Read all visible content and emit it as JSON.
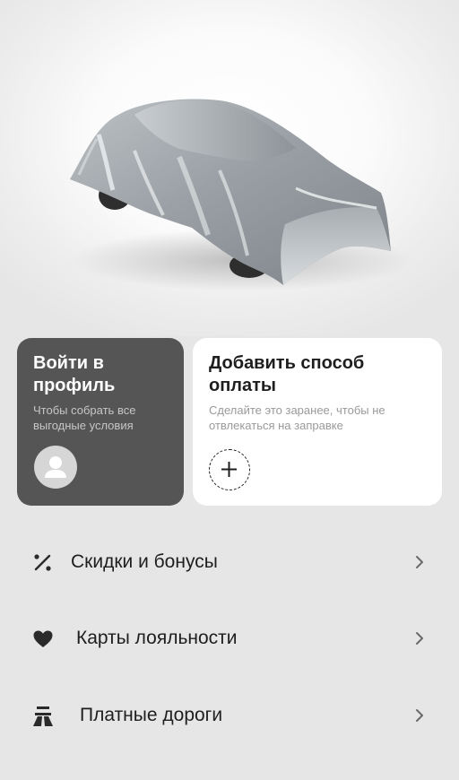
{
  "login_card": {
    "title": "Войти в профиль",
    "subtitle": "Чтобы собрать все выгодные условия"
  },
  "payment_card": {
    "title": "Добавить способ оплаты",
    "subtitle": "Сделайте это заранее, чтобы не отвлекаться на заправке"
  },
  "menu": {
    "items": [
      {
        "label": "Скидки и бонусы",
        "icon": "percent-icon"
      },
      {
        "label": "Карты лояльности",
        "icon": "heart-icon"
      },
      {
        "label": "Платные дороги",
        "icon": "road-icon"
      }
    ]
  },
  "colors": {
    "background": "#e6e6e6",
    "login_card_bg": "#555555",
    "payment_card_bg": "#ffffff",
    "text_primary": "#1e1e1e"
  }
}
